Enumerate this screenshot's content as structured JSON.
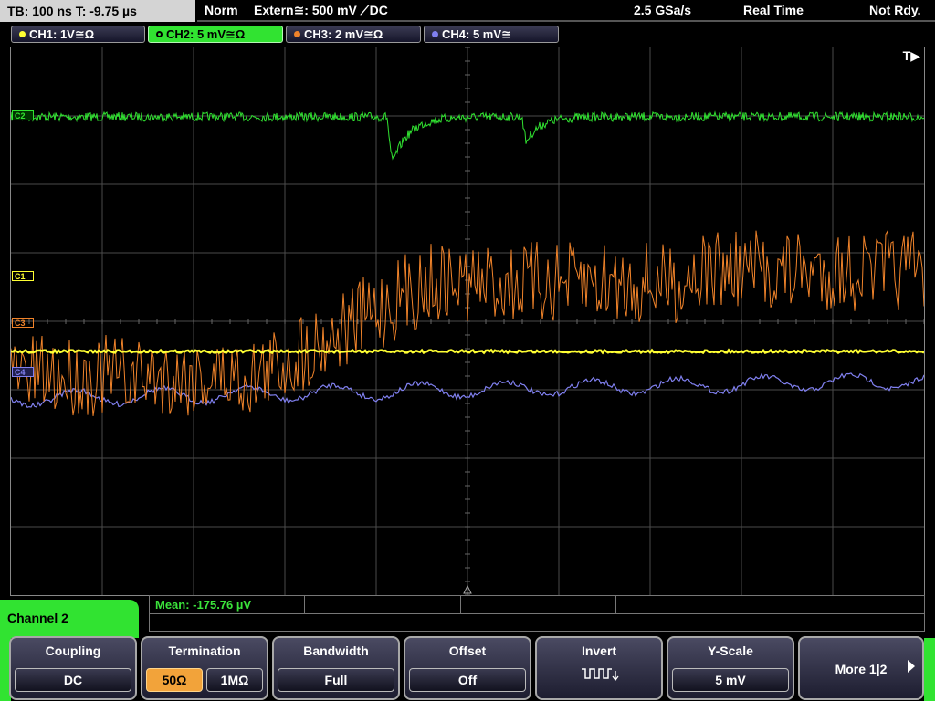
{
  "status": {
    "timebase": "TB: 100 ns   T: -9.75 µs",
    "mode": "Norm",
    "trigger": "Extern≅: 500 mV ⟋DC",
    "sample_rate": "2.5 GSa/s",
    "acq_mode": "Real Time",
    "state": "Not Rdy."
  },
  "channels": [
    {
      "label": "CH1: 1V≅Ω",
      "color": "#ffff33"
    },
    {
      "label": "CH2: 5 mV≅Ω",
      "color": "#31e331"
    },
    {
      "label": "CH3: 2 mV≅Ω",
      "color": "#f0832a"
    },
    {
      "label": "CH4: 5 mV≅",
      "color": "#8080f0"
    }
  ],
  "screen": {
    "trigger_marker": "T▶",
    "markers": {
      "c1": "C1",
      "c2": "C2",
      "c3": "C3",
      "c4": "C4"
    }
  },
  "measurement": {
    "mean": "Mean: -175.76 µV"
  },
  "menu": {
    "title": "Channel 2",
    "coupling": {
      "title": "Coupling",
      "value": "DC"
    },
    "termination": {
      "title": "Termination",
      "opt1": "50Ω",
      "opt2": "1MΩ"
    },
    "bandwidth": {
      "title": "Bandwidth",
      "value": "Full"
    },
    "offset": {
      "title": "Offset",
      "value": "Off"
    },
    "invert": {
      "title": "Invert",
      "icon": "square-wave-icon"
    },
    "yscale": {
      "title": "Y-Scale",
      "value": "5 mV"
    },
    "more": {
      "title": "More 1|2"
    }
  }
}
